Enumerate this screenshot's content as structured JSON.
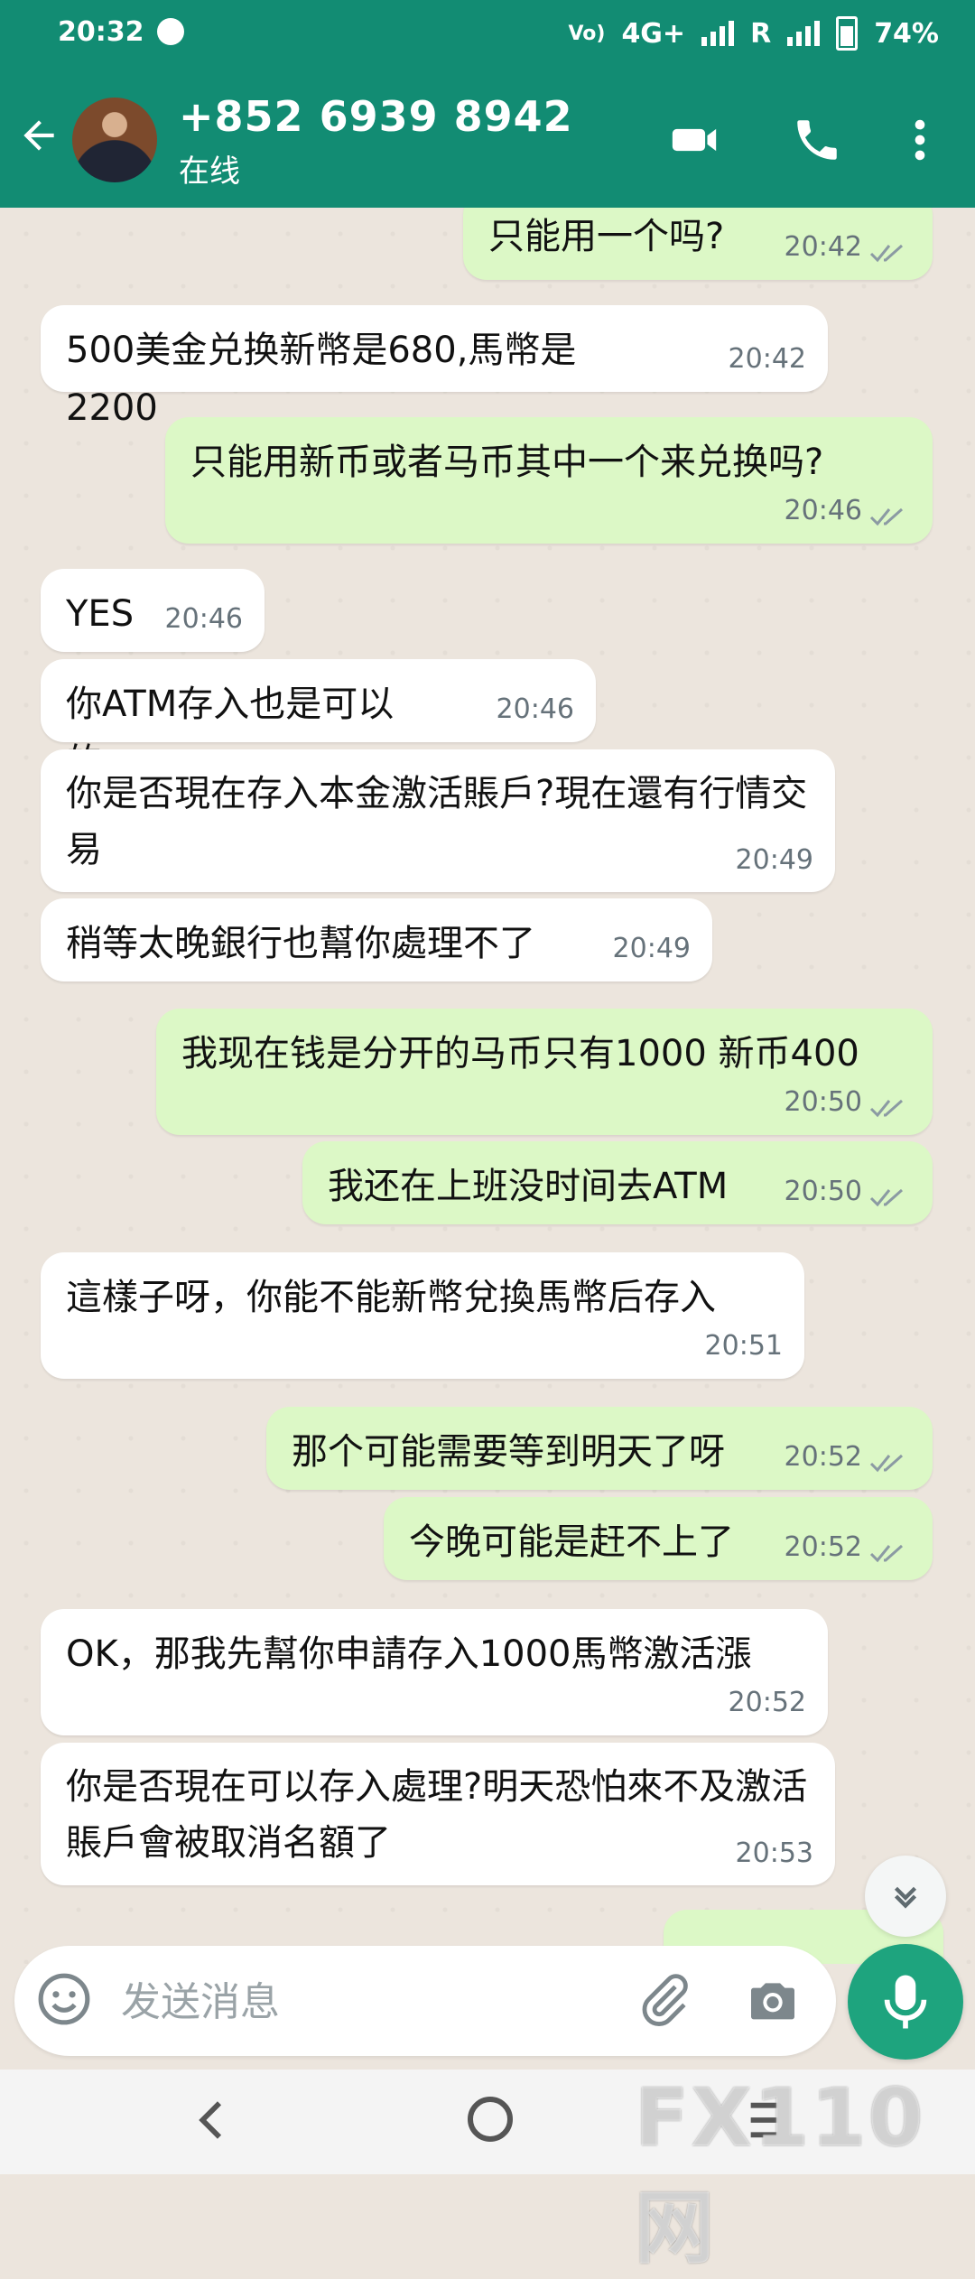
{
  "status_bar": {
    "time": "20:32",
    "network_label": "4G+",
    "roaming": "R",
    "battery": "74%"
  },
  "header": {
    "contact_name": "+852 6939 8942",
    "presence": "在线"
  },
  "messages": [
    {
      "dir": "out",
      "text": "只能用一个吗?",
      "time": "20:42"
    },
    {
      "dir": "in",
      "text": "500美金兑换新幣是680,馬幣是2200",
      "time": "20:42"
    },
    {
      "dir": "out",
      "text": "只能用新币或者马币其中一个来兑换吗?",
      "time": "20:46"
    },
    {
      "dir": "in",
      "text": "YES",
      "time": "20:46"
    },
    {
      "dir": "in",
      "text": "你ATM存入也是可以的",
      "time": "20:46"
    },
    {
      "dir": "in",
      "text": "你是否現在存入本金激活賬戶?現在還有行情交易",
      "time": "20:49"
    },
    {
      "dir": "in",
      "text": "稍等太晚銀行也幫你處理不了",
      "time": "20:49"
    },
    {
      "dir": "out",
      "text": "我现在钱是分开的马币只有1000 新币400",
      "time": "20:50"
    },
    {
      "dir": "out",
      "text": "我还在上班没时间去ATM",
      "time": "20:50"
    },
    {
      "dir": "in",
      "text": "這樣子呀，你能不能新幣兌換馬幣后存入",
      "time": "20:51"
    },
    {
      "dir": "out",
      "text": "那个可能需要等到明天了呀",
      "time": "20:52"
    },
    {
      "dir": "out",
      "text": "今晚可能是赶不上了",
      "time": "20:52"
    },
    {
      "dir": "in",
      "text": "OK，那我先幫你申請存入1000馬幣激活漲",
      "time": "20:52"
    },
    {
      "dir": "in",
      "text": "你是否現在可以存入處理?明天恐怕來不及激活賬戶會被取消名額了",
      "time": "20:53"
    }
  ],
  "composer": {
    "placeholder": "发送消息"
  },
  "watermark": "FX110网",
  "colors": {
    "header": "#128c73",
    "outgoing": "#dcf8c6",
    "incoming": "#ffffff",
    "mic": "#1ea47e"
  },
  "icons": [
    "back-arrow-icon",
    "video-call-icon",
    "phone-icon",
    "more-vert-icon",
    "emoji-icon",
    "attach-icon",
    "camera-icon",
    "mic-icon",
    "chevron-down-icon",
    "nav-back-icon",
    "nav-home-icon",
    "nav-recents-icon"
  ]
}
